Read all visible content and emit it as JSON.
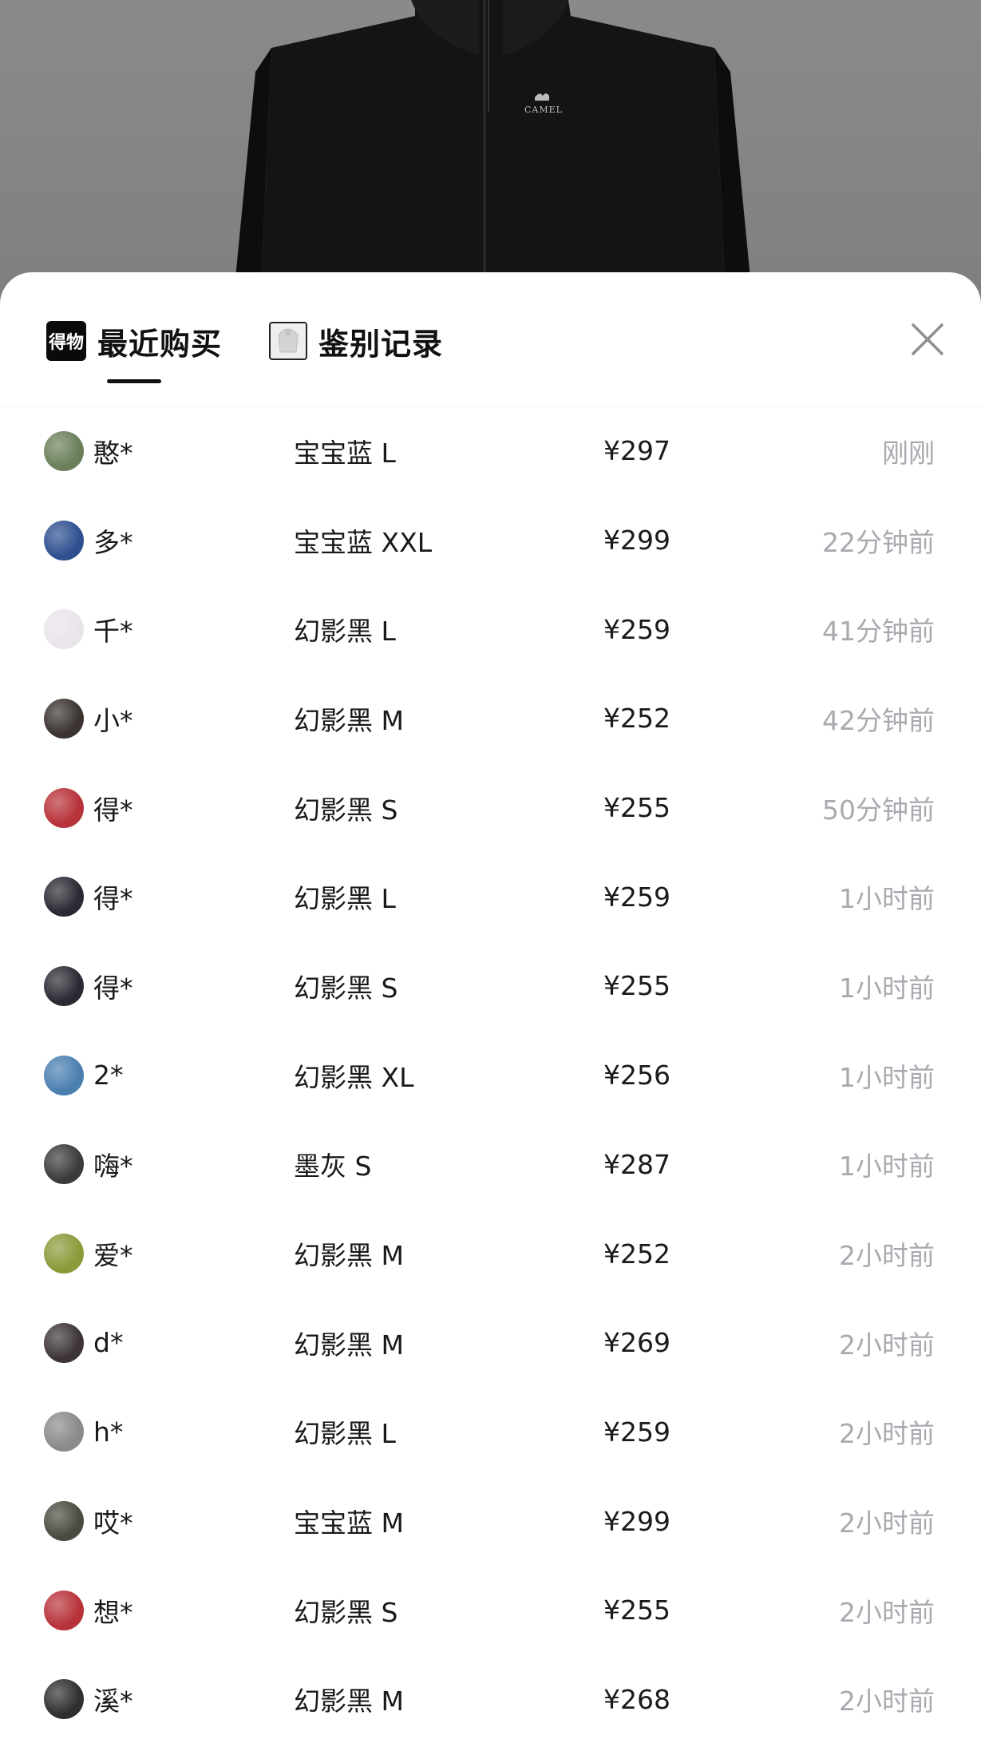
{
  "hero": {
    "logo_text": "CAMEL"
  },
  "tabs": [
    {
      "label": "最近购买",
      "icon": "brand-logo-icon",
      "icon_text": "得物",
      "active": true
    },
    {
      "label": "鉴别记录",
      "icon": "product-thumb-icon",
      "active": false
    }
  ],
  "close": {
    "icon": "close-icon"
  },
  "colors": {
    "accent": "#111111",
    "muted": "#a9a9b0"
  },
  "purchases": [
    {
      "name": "憨*",
      "spec": "宝宝蓝 L",
      "price": "¥297",
      "time": "刚刚",
      "avatar": "#6b7f5a"
    },
    {
      "name": "多*",
      "spec": "宝宝蓝 XXL",
      "price": "¥299",
      "time": "22分钟前",
      "avatar": "#2e4f8f"
    },
    {
      "name": "千*",
      "spec": "幻影黑 L",
      "price": "¥259",
      "time": "41分钟前",
      "avatar": "#e9e4ea"
    },
    {
      "name": "小*",
      "spec": "幻影黑 M",
      "price": "¥252",
      "time": "42分钟前",
      "avatar": "#3a3330"
    },
    {
      "name": "得*",
      "spec": "幻影黑 S",
      "price": "¥255",
      "time": "50分钟前",
      "avatar": "#b8323a"
    },
    {
      "name": "得*",
      "spec": "幻影黑 L",
      "price": "¥259",
      "time": "1小时前",
      "avatar": "#2a2a33"
    },
    {
      "name": "得*",
      "spec": "幻影黑 S",
      "price": "¥255",
      "time": "1小时前",
      "avatar": "#2a2a33"
    },
    {
      "name": "2*",
      "spec": "幻影黑 XL",
      "price": "¥256",
      "time": "1小时前",
      "avatar": "#4a7fb0"
    },
    {
      "name": "嗨*",
      "spec": "墨灰 S",
      "price": "¥287",
      "time": "1小时前",
      "avatar": "#3b3b3b"
    },
    {
      "name": "爱*",
      "spec": "幻影黑 M",
      "price": "¥252",
      "time": "2小时前",
      "avatar": "#8c9a3a"
    },
    {
      "name": "d*",
      "spec": "幻影黑 M",
      "price": "¥269",
      "time": "2小时前",
      "avatar": "#3d3535"
    },
    {
      "name": "h*",
      "spec": "幻影黑 L",
      "price": "¥259",
      "time": "2小时前",
      "avatar": "#8a8a8a"
    },
    {
      "name": "哎*",
      "spec": "宝宝蓝 M",
      "price": "¥299",
      "time": "2小时前",
      "avatar": "#4a4a40"
    },
    {
      "name": "想*",
      "spec": "幻影黑 S",
      "price": "¥255",
      "time": "2小时前",
      "avatar": "#b8323a"
    },
    {
      "name": "溪*",
      "spec": "幻影黑 M",
      "price": "¥268",
      "time": "2小时前",
      "avatar": "#2f2f2f"
    }
  ]
}
